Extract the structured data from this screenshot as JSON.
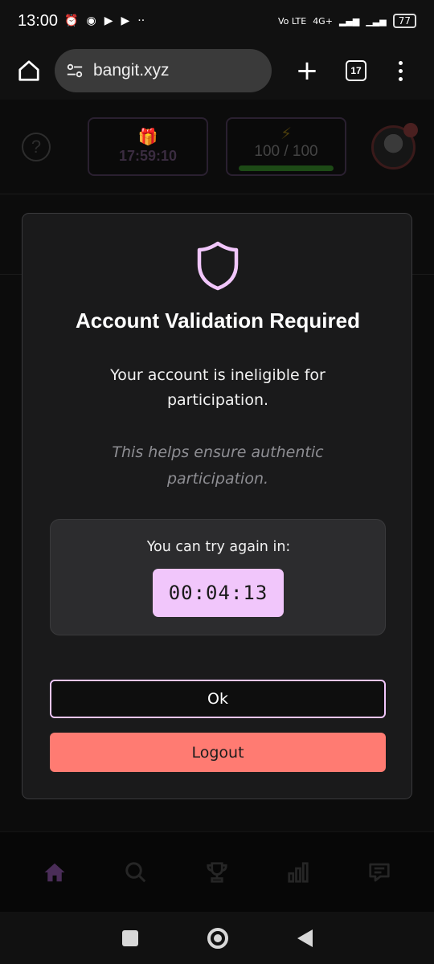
{
  "status_bar": {
    "time": "13:00",
    "network": "4G+",
    "volte": "Vo LTE",
    "battery": "77"
  },
  "browser": {
    "url": "bangit.xyz",
    "tab_count": "17"
  },
  "header": {
    "help_symbol": "?",
    "timer": "17:59:10",
    "energy": "100 / 100",
    "energy_fraction": 1.0
  },
  "modal": {
    "title": "Account Validation Required",
    "message": "Your account is ineligible for participation.",
    "note": "This helps ensure authentic participation.",
    "countdown_label": "You can try again in:",
    "countdown_value": "00:04:13",
    "ok_label": "Ok",
    "logout_label": "Logout"
  },
  "bottom_nav": {
    "items": [
      "home-icon",
      "search-icon",
      "trophy-icon",
      "leaderboard-icon",
      "chat-icon"
    ]
  },
  "colors": {
    "accent": "#f1c6fb",
    "danger": "#ff7b72",
    "modal_bg": "#1a1a1b"
  }
}
